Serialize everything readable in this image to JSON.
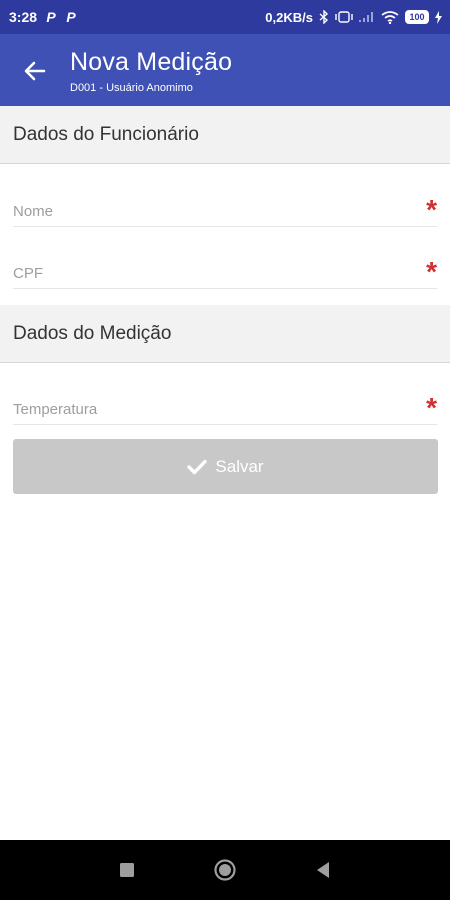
{
  "status_bar": {
    "time": "3:28",
    "notif_icons": [
      "P",
      "P"
    ],
    "network_speed": "0,2KB/s",
    "battery": "100"
  },
  "app_bar": {
    "title": "Nova Medição",
    "subtitle": "D001 - Usuário Anomimo",
    "background": "#3f51b5"
  },
  "sections": {
    "employee": {
      "title": "Dados do Funcionário",
      "name_placeholder": "Nome",
      "cpf_placeholder": "CPF"
    },
    "measurement": {
      "title": "Dados do Medição",
      "temperature_placeholder": "Temperatura"
    }
  },
  "required_marker": "*",
  "save_button": {
    "label": "Salvar",
    "icon": "check-icon"
  },
  "nav_bar": {
    "icons": [
      "recents-icon",
      "home-icon",
      "back-icon"
    ]
  }
}
